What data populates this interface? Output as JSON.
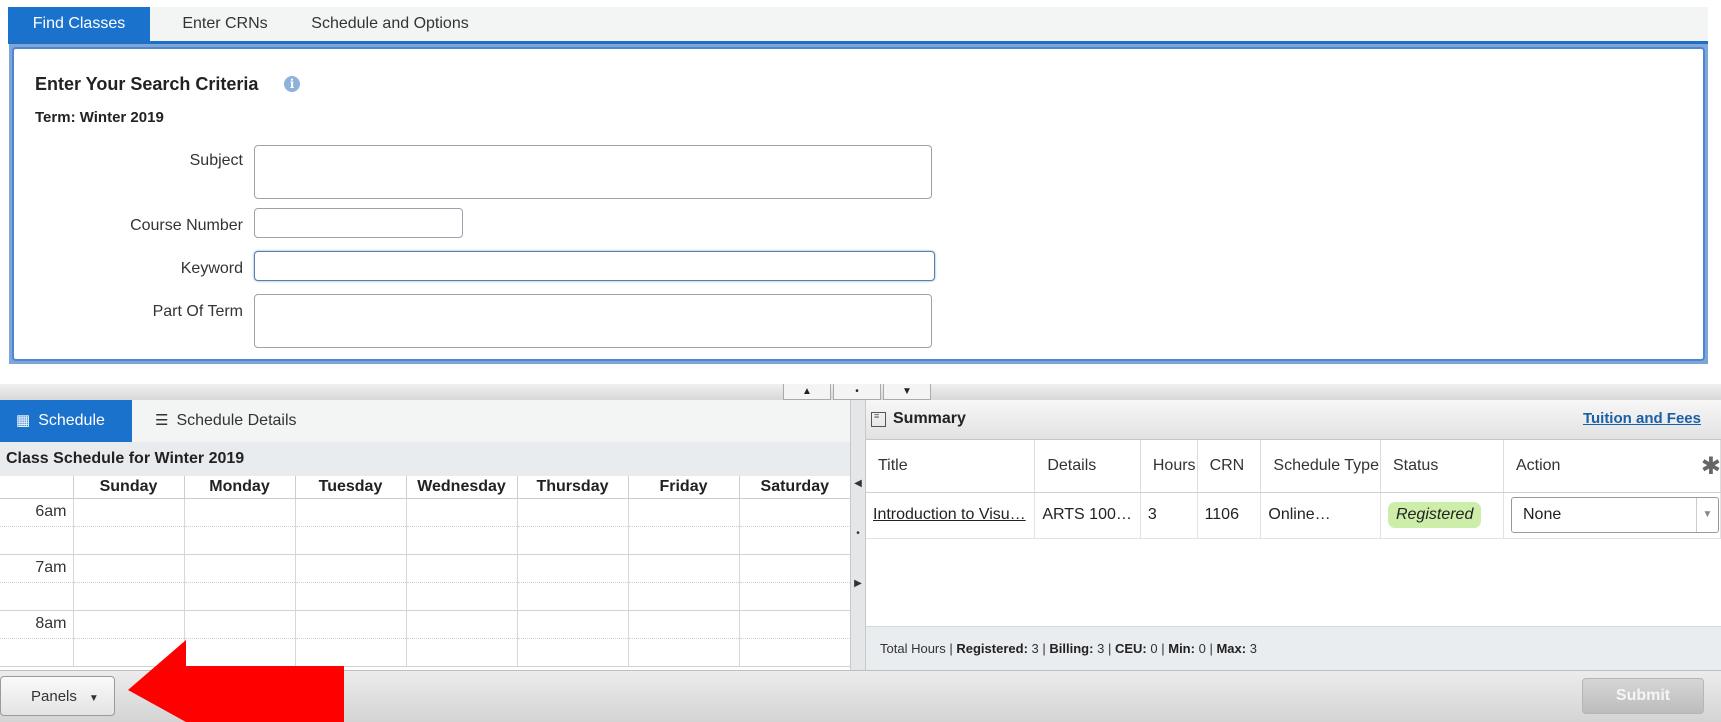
{
  "top_tabs": [
    "Find Classes",
    "Enter CRNs",
    "Schedule and Options"
  ],
  "search": {
    "title": "Enter Your Search Criteria",
    "info_icon": "i",
    "term": "Term: Winter 2019",
    "fields": {
      "subject": {
        "label": "Subject",
        "value": ""
      },
      "course_number": {
        "label": "Course Number",
        "value": ""
      },
      "keyword": {
        "label": "Keyword",
        "value": ""
      },
      "part_of_term": {
        "label": "Part Of Term",
        "value": ""
      }
    }
  },
  "splitter": {
    "up": "▲",
    "middle": "•",
    "down": "▼"
  },
  "vsplit": {
    "left": "◀",
    "middle": "•",
    "right": "▶"
  },
  "schedule": {
    "tabs": [
      {
        "label": "Schedule",
        "icon": "calendar-icon",
        "glyph": "▦"
      },
      {
        "label": "Schedule Details",
        "icon": "list-icon",
        "glyph": "☰"
      }
    ],
    "caption": "Class Schedule for Winter 2019",
    "days": [
      "Sunday",
      "Monday",
      "Tuesday",
      "Wednesday",
      "Thursday",
      "Friday",
      "Saturday"
    ],
    "times": [
      "6am",
      "",
      "7am",
      "",
      "8am",
      ""
    ]
  },
  "summary": {
    "title": "Summary",
    "tuition_link": "Tuition and Fees",
    "columns": [
      "Title",
      "Details",
      "Hours",
      "CRN",
      "Schedule Type",
      "Status",
      "Action"
    ],
    "rows": [
      {
        "title": "Introduction to Visu…",
        "details": "ARTS 100…",
        "hours": "3",
        "crn": "1106",
        "schedule_type": "Online…",
        "status": "Registered",
        "action": "None"
      }
    ],
    "totals": {
      "prefix": "Total Hours |",
      "registered_label": "Registered:",
      "registered": "3",
      "billing_label": "Billing:",
      "billing": "3",
      "ceu_label": "CEU:",
      "ceu": "0",
      "min_label": "Min:",
      "min": "0",
      "max_label": "Max:",
      "max": "3",
      "sep": "|"
    }
  },
  "footer": {
    "panels_label": "Panels",
    "submit_label": "Submit"
  },
  "colors": {
    "accent": "#1b72cc",
    "registered_bg": "#cdeea9",
    "annotation_arrow": "#ff0000"
  }
}
